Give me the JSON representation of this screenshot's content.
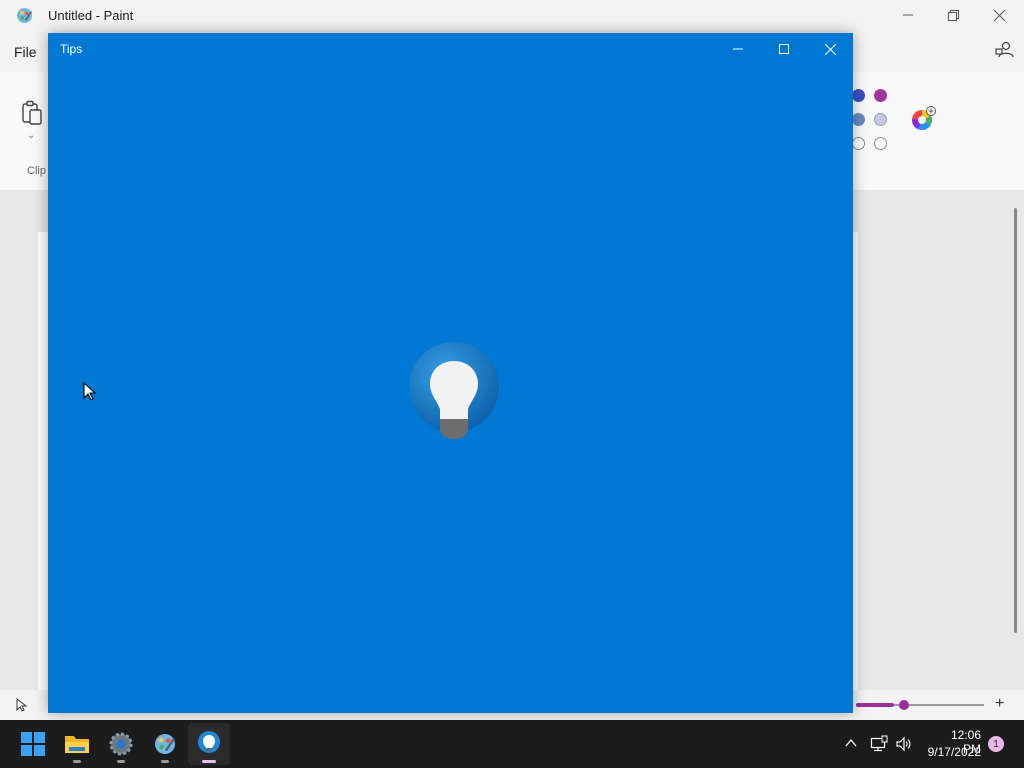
{
  "paint": {
    "title": "Untitled - Paint",
    "menu": {
      "file": "File"
    },
    "ribbon": {
      "clipboard_label": "Clip"
    },
    "colors": {
      "row1": [
        "#3a4fc4",
        "#a0339e"
      ],
      "row2": [
        "#6a8ac4",
        "#c6c6e6"
      ],
      "row3": [
        "#ffffff",
        "#ffffff"
      ]
    },
    "zoom_level": 0.3
  },
  "tips": {
    "title": "Tips",
    "background": "#0078d4",
    "logo_icon": "lightbulb-icon"
  },
  "taskbar": {
    "apps": [
      "start-icon",
      "file-explorer-icon",
      "settings-icon",
      "paint-icon",
      "tips-icon"
    ],
    "time": "12:06 PM",
    "date": "9/17/2022",
    "notification_count": "1"
  }
}
